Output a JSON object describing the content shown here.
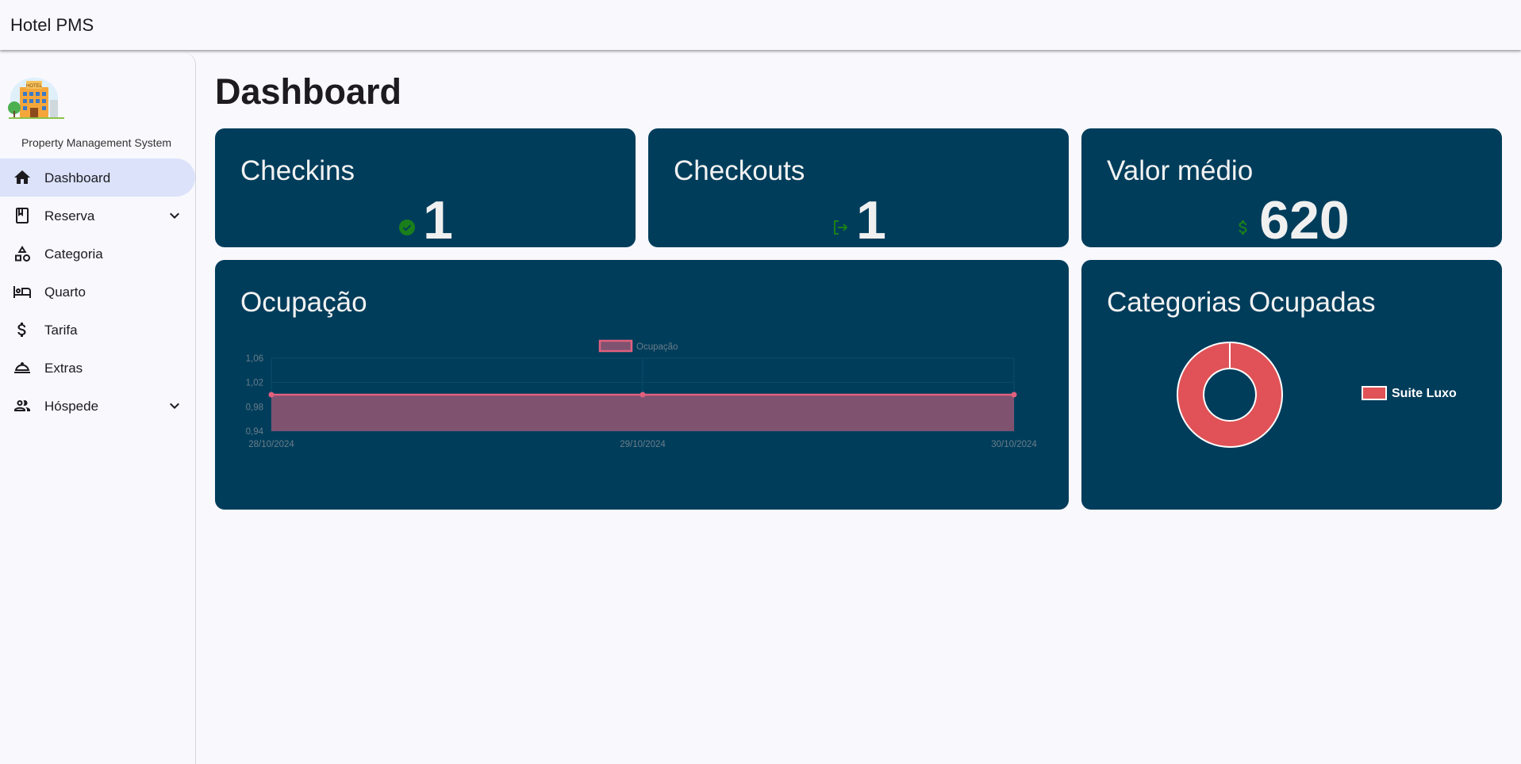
{
  "app": {
    "title": "Hotel PMS"
  },
  "sidebar": {
    "subtitle": "Property Management System",
    "logo": {
      "icon": "hotel-building-logo",
      "text": "HOTEL"
    },
    "items": [
      {
        "label": "Dashboard",
        "icon": "home-icon",
        "active": true,
        "expandable": false
      },
      {
        "label": "Reserva",
        "icon": "book-icon",
        "active": false,
        "expandable": true
      },
      {
        "label": "Categoria",
        "icon": "shapes-icon",
        "active": false,
        "expandable": false
      },
      {
        "label": "Quarto",
        "icon": "bed-icon",
        "active": false,
        "expandable": false
      },
      {
        "label": "Tarifa",
        "icon": "dollar-icon",
        "active": false,
        "expandable": false
      },
      {
        "label": "Extras",
        "icon": "room-service-icon",
        "active": false,
        "expandable": false
      },
      {
        "label": "Hóspede",
        "icon": "people-icon",
        "active": false,
        "expandable": true
      }
    ]
  },
  "main": {
    "title": "Dashboard",
    "cards": {
      "checkins": {
        "title": "Checkins",
        "value": "1",
        "icon": "check-circle-icon"
      },
      "checkouts": {
        "title": "Checkouts",
        "value": "1",
        "icon": "logout-icon"
      },
      "valor_medio": {
        "title": "Valor médio",
        "value": "620",
        "icon": "dollar-icon"
      },
      "ocupacao": {
        "title": "Ocupação"
      },
      "categorias": {
        "title": "Categorias Ocupadas"
      }
    }
  },
  "colors": {
    "card_bg": "#003d5b",
    "accent_green": "#1a7f1a",
    "line": "#e0607e",
    "area_fill": "#7f5270",
    "pie": "#e05257",
    "nav_active": "#dbe2f9"
  },
  "chart_data": [
    {
      "type": "area",
      "legend": [
        "Ocupação"
      ],
      "categories": [
        "28/10/2024",
        "29/10/2024",
        "30/10/2024"
      ],
      "series": [
        {
          "name": "Ocupação",
          "values": [
            1,
            1,
            1
          ]
        }
      ],
      "yticks": [
        "1,06",
        "1,02",
        "0,98",
        "0,94"
      ],
      "ylim": [
        0.94,
        1.06
      ],
      "grid": true,
      "legend_position": "top-center"
    },
    {
      "type": "pie",
      "variant": "doughnut",
      "labels": [
        "Suite Luxo"
      ],
      "values": [
        1
      ],
      "legend_position": "right"
    }
  ]
}
